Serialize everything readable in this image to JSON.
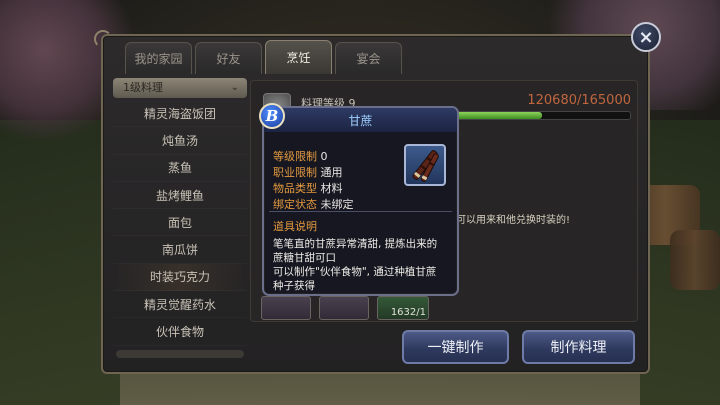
{
  "tabs": [
    {
      "label": "我的家园",
      "active": false
    },
    {
      "label": "好友",
      "active": false
    },
    {
      "label": "烹饪",
      "active": true
    },
    {
      "label": "宴会",
      "active": false
    }
  ],
  "close_label": "×",
  "sidebar": {
    "dropdown_label": "1级料理",
    "items": [
      {
        "label": "精灵海盗饭团"
      },
      {
        "label": "炖鱼汤"
      },
      {
        "label": "蒸鱼"
      },
      {
        "label": "盐烤鲤鱼"
      },
      {
        "label": "面包"
      },
      {
        "label": "南瓜饼"
      },
      {
        "label": "时装巧克力"
      },
      {
        "label": "精灵觉醒药水"
      },
      {
        "label": "伙伴食物"
      }
    ]
  },
  "cooking": {
    "level_label": "料理等级 9",
    "exp_text": "120680/165000",
    "exp_progress": 0.7314,
    "description_partial": "可以用来和他兑换时装的!",
    "slot_count_text": "1632/1"
  },
  "buttons": {
    "one_click": "一键制作",
    "make": "制作料理"
  },
  "tooltip": {
    "badge": "B",
    "title": "甘蔗",
    "props": [
      {
        "key": "等级限制",
        "value": "0"
      },
      {
        "key": "职业限制",
        "value": "通用"
      },
      {
        "key": "物品类型",
        "value": "材料"
      },
      {
        "key": "绑定状态",
        "value": "未绑定"
      }
    ],
    "section_title": "道具说明",
    "desc_lines": [
      "笔笔直的甘蔗异常清甜, 提炼出来的",
      "蔗糖甘甜可口",
      "可以制作\"伙伴食物\", 通过种植甘蔗",
      "种子获得"
    ]
  }
}
